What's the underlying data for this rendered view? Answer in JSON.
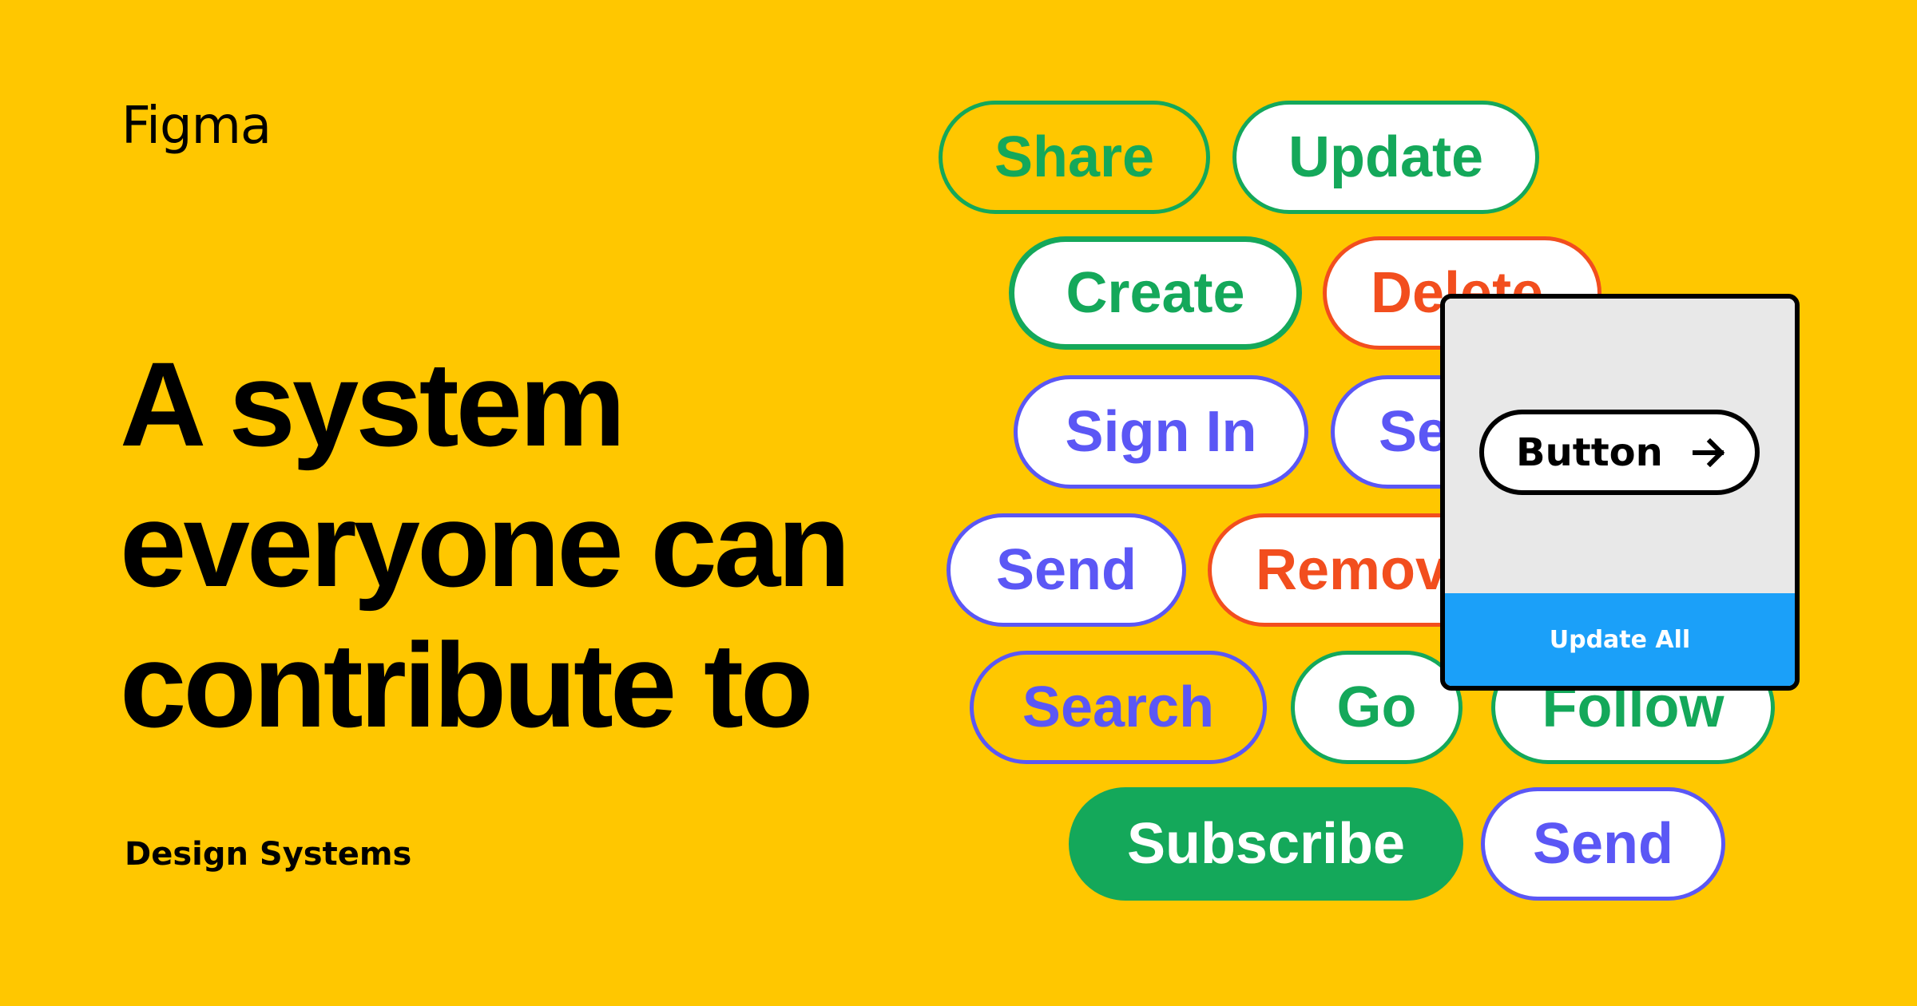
{
  "brand": {
    "logo_text": "Figma"
  },
  "headline": {
    "lines": [
      "A system",
      "everyone can",
      "contribute to"
    ]
  },
  "category_tag": "Design Systems",
  "colors": {
    "background": "#FFC700",
    "green": "#14A85A",
    "red": "#F24E1E",
    "purple": "#5B57F5",
    "blue": "#1BA0F9",
    "card_gray": "#E8E8E8"
  },
  "buttons": [
    {
      "label": "Share",
      "style": "outline-clear",
      "color": "green"
    },
    {
      "label": "Update",
      "style": "outline",
      "color": "green"
    },
    {
      "label": "Create",
      "style": "outline",
      "color": "green"
    },
    {
      "label": "Delete",
      "style": "outline",
      "color": "red"
    },
    {
      "label": "Sign In",
      "style": "outline",
      "color": "purple"
    },
    {
      "label": "Send",
      "style": "outline",
      "color": "purple"
    },
    {
      "label": "Send",
      "style": "outline",
      "color": "purple"
    },
    {
      "label": "Remove",
      "style": "outline",
      "color": "red"
    },
    {
      "label": "Search",
      "style": "outline-clear",
      "color": "purple"
    },
    {
      "label": "Go",
      "style": "outline",
      "color": "green"
    },
    {
      "label": "Follow",
      "style": "outline",
      "color": "green"
    },
    {
      "label": "Subscribe",
      "style": "solid",
      "color": "green"
    },
    {
      "label": "Send",
      "style": "outline",
      "color": "purple"
    }
  ],
  "component_card": {
    "preview_button_label": "Button",
    "preview_button_icon": "arrow-right-icon",
    "footer_action_label": "Update All"
  }
}
